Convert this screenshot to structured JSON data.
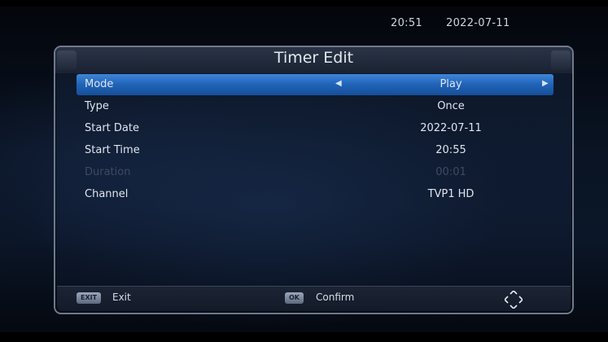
{
  "status": {
    "time": "20:51",
    "date": "2022-07-11"
  },
  "dialog": {
    "title": "Timer Edit",
    "rows": [
      {
        "label": "Mode",
        "value": "Play",
        "selected": true
      },
      {
        "label": "Type",
        "value": "Once"
      },
      {
        "label": "Start Date",
        "value": "2022-07-11"
      },
      {
        "label": "Start Time",
        "value": "20:55"
      },
      {
        "label": "Duration",
        "value": "00:01",
        "disabled": true
      },
      {
        "label": "Channel",
        "value": "TVP1 HD"
      }
    ]
  },
  "footer": {
    "exit_key": "EXIT",
    "exit_label": "Exit",
    "ok_key": "OK",
    "ok_label": "Confirm"
  },
  "icons": {
    "left_arrow": "left-arrow-icon",
    "right_arrow": "right-arrow-icon",
    "nav": "navigation-diamond-icon"
  },
  "colors": {
    "selection": "#1f63b8",
    "panel_border": "#6f7a8c",
    "text": "#dfe5ee",
    "disabled_text": "#3d4a60"
  }
}
